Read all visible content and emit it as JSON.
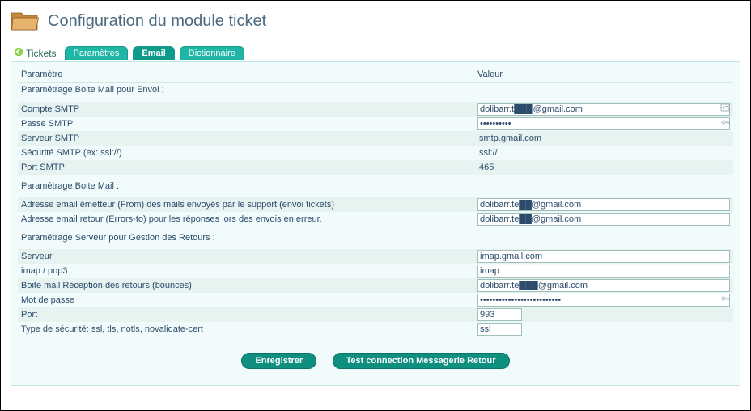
{
  "header": {
    "title": "Configuration du module ticket",
    "back_label": "Tickets"
  },
  "tabs": [
    {
      "label": "Paramètres",
      "active": false
    },
    {
      "label": "Email",
      "active": true
    },
    {
      "label": "Dictionnaire",
      "active": false
    }
  ],
  "columns": {
    "param": "Paramètre",
    "value": "Valeur"
  },
  "sections": {
    "send": {
      "title": "Paramétrage Boite Mail pour Envoi :",
      "rows": {
        "smtp_account": {
          "label": "Compte SMTP",
          "value": "dolibarr.t███@gmail.com"
        },
        "smtp_pass": {
          "label": "Passe SMTP",
          "value": "••••••••••"
        },
        "smtp_server": {
          "label": "Serveur SMTP",
          "value": "smtp.gmail.com"
        },
        "smtp_security": {
          "label": "Sécurité SMTP (ex: ssl://)",
          "value": "ssl://"
        },
        "smtp_port": {
          "label": "Port SMTP",
          "value": "465"
        }
      }
    },
    "mailbox": {
      "title": "Paramétrage Boite Mail :",
      "rows": {
        "from": {
          "label": "Adresse email émetteur (From) des mails envoyés par le support (envoi tickets)",
          "value": "dolibarr.te██@gmail.com"
        },
        "errors_to": {
          "label": "Adresse email retour (Errors-to) pour les réponses lors des envois en erreur.",
          "value": "dolibarr.te██@gmail.com"
        }
      }
    },
    "returns": {
      "title": "Paramétrage Serveur pour Gestion des Retours :",
      "rows": {
        "server": {
          "label": "Serveur",
          "value": "imap.gmail.com"
        },
        "proto": {
          "label": "imap / pop3",
          "value": "imap"
        },
        "bounces": {
          "label": "Boite mail Réception des retours (bounces)",
          "value": "dolibarr.te███@gmail.com"
        },
        "password": {
          "label": "Mot de passe",
          "value": "••••••••••••••••••••••••••"
        },
        "port": {
          "label": "Port",
          "value": "993"
        },
        "sectype": {
          "label": "Type de sécurité: ssl, tls, notls, novalidate-cert",
          "value": "ssl"
        }
      }
    }
  },
  "buttons": {
    "save": "Enregistrer",
    "test": "Test connection Messagerie Retour"
  }
}
